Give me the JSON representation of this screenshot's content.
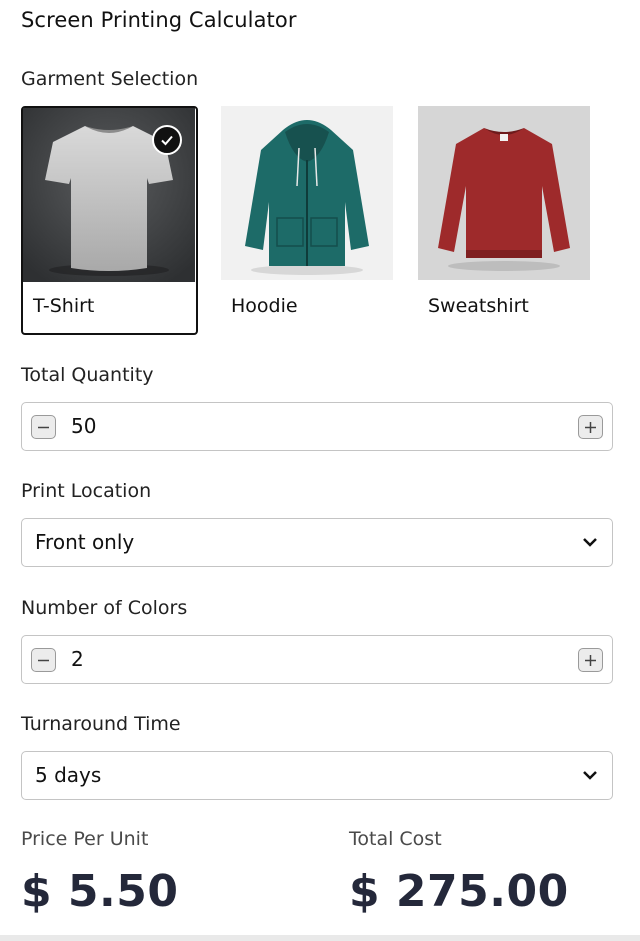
{
  "title": "Screen Printing Calculator",
  "garment_selection": {
    "label": "Garment Selection",
    "options": [
      {
        "name": "T-Shirt",
        "selected": true,
        "image": "white-tshirt"
      },
      {
        "name": "Hoodie",
        "selected": false,
        "image": "teal-hoodie"
      },
      {
        "name": "Sweatshirt",
        "selected": false,
        "image": "red-sweatshirt"
      }
    ]
  },
  "quantity": {
    "label": "Total Quantity",
    "value": "50"
  },
  "print_location": {
    "label": "Print Location",
    "value": "Front only"
  },
  "colors": {
    "label": "Number of Colors",
    "value": "2"
  },
  "turnaround": {
    "label": "Turnaround Time",
    "value": "5 days"
  },
  "price_per_unit": {
    "label": "Price Per Unit",
    "value": "$ 5.50"
  },
  "total_cost": {
    "label": "Total Cost",
    "value": "$ 275.00"
  },
  "icons": {
    "selected": "checkmark-icon",
    "decrement": "minus-icon",
    "increment": "plus-icon",
    "dropdown": "chevron-down-icon"
  }
}
